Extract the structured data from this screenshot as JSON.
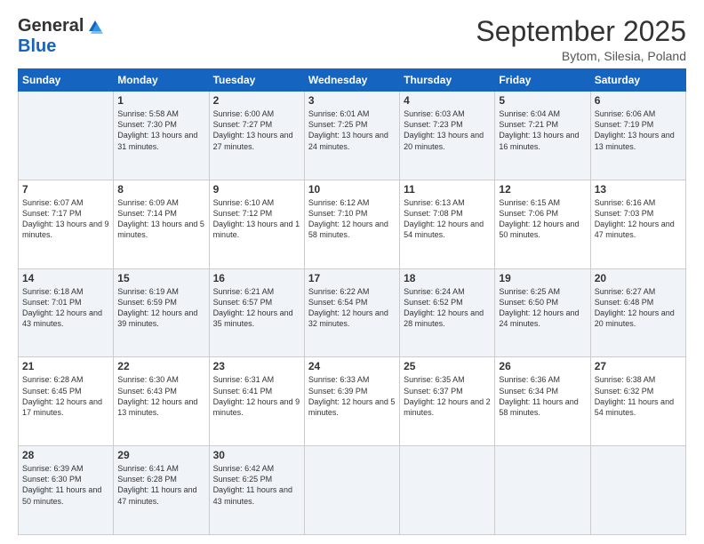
{
  "header": {
    "logo_general": "General",
    "logo_blue": "Blue",
    "month_title": "September 2025",
    "location": "Bytom, Silesia, Poland"
  },
  "weekdays": [
    "Sunday",
    "Monday",
    "Tuesday",
    "Wednesday",
    "Thursday",
    "Friday",
    "Saturday"
  ],
  "weeks": [
    [
      {
        "day": "",
        "sunrise": "",
        "sunset": "",
        "daylight": ""
      },
      {
        "day": "1",
        "sunrise": "Sunrise: 5:58 AM",
        "sunset": "Sunset: 7:30 PM",
        "daylight": "Daylight: 13 hours and 31 minutes."
      },
      {
        "day": "2",
        "sunrise": "Sunrise: 6:00 AM",
        "sunset": "Sunset: 7:27 PM",
        "daylight": "Daylight: 13 hours and 27 minutes."
      },
      {
        "day": "3",
        "sunrise": "Sunrise: 6:01 AM",
        "sunset": "Sunset: 7:25 PM",
        "daylight": "Daylight: 13 hours and 24 minutes."
      },
      {
        "day": "4",
        "sunrise": "Sunrise: 6:03 AM",
        "sunset": "Sunset: 7:23 PM",
        "daylight": "Daylight: 13 hours and 20 minutes."
      },
      {
        "day": "5",
        "sunrise": "Sunrise: 6:04 AM",
        "sunset": "Sunset: 7:21 PM",
        "daylight": "Daylight: 13 hours and 16 minutes."
      },
      {
        "day": "6",
        "sunrise": "Sunrise: 6:06 AM",
        "sunset": "Sunset: 7:19 PM",
        "daylight": "Daylight: 13 hours and 13 minutes."
      }
    ],
    [
      {
        "day": "7",
        "sunrise": "Sunrise: 6:07 AM",
        "sunset": "Sunset: 7:17 PM",
        "daylight": "Daylight: 13 hours and 9 minutes."
      },
      {
        "day": "8",
        "sunrise": "Sunrise: 6:09 AM",
        "sunset": "Sunset: 7:14 PM",
        "daylight": "Daylight: 13 hours and 5 minutes."
      },
      {
        "day": "9",
        "sunrise": "Sunrise: 6:10 AM",
        "sunset": "Sunset: 7:12 PM",
        "daylight": "Daylight: 13 hours and 1 minute."
      },
      {
        "day": "10",
        "sunrise": "Sunrise: 6:12 AM",
        "sunset": "Sunset: 7:10 PM",
        "daylight": "Daylight: 12 hours and 58 minutes."
      },
      {
        "day": "11",
        "sunrise": "Sunrise: 6:13 AM",
        "sunset": "Sunset: 7:08 PM",
        "daylight": "Daylight: 12 hours and 54 minutes."
      },
      {
        "day": "12",
        "sunrise": "Sunrise: 6:15 AM",
        "sunset": "Sunset: 7:06 PM",
        "daylight": "Daylight: 12 hours and 50 minutes."
      },
      {
        "day": "13",
        "sunrise": "Sunrise: 6:16 AM",
        "sunset": "Sunset: 7:03 PM",
        "daylight": "Daylight: 12 hours and 47 minutes."
      }
    ],
    [
      {
        "day": "14",
        "sunrise": "Sunrise: 6:18 AM",
        "sunset": "Sunset: 7:01 PM",
        "daylight": "Daylight: 12 hours and 43 minutes."
      },
      {
        "day": "15",
        "sunrise": "Sunrise: 6:19 AM",
        "sunset": "Sunset: 6:59 PM",
        "daylight": "Daylight: 12 hours and 39 minutes."
      },
      {
        "day": "16",
        "sunrise": "Sunrise: 6:21 AM",
        "sunset": "Sunset: 6:57 PM",
        "daylight": "Daylight: 12 hours and 35 minutes."
      },
      {
        "day": "17",
        "sunrise": "Sunrise: 6:22 AM",
        "sunset": "Sunset: 6:54 PM",
        "daylight": "Daylight: 12 hours and 32 minutes."
      },
      {
        "day": "18",
        "sunrise": "Sunrise: 6:24 AM",
        "sunset": "Sunset: 6:52 PM",
        "daylight": "Daylight: 12 hours and 28 minutes."
      },
      {
        "day": "19",
        "sunrise": "Sunrise: 6:25 AM",
        "sunset": "Sunset: 6:50 PM",
        "daylight": "Daylight: 12 hours and 24 minutes."
      },
      {
        "day": "20",
        "sunrise": "Sunrise: 6:27 AM",
        "sunset": "Sunset: 6:48 PM",
        "daylight": "Daylight: 12 hours and 20 minutes."
      }
    ],
    [
      {
        "day": "21",
        "sunrise": "Sunrise: 6:28 AM",
        "sunset": "Sunset: 6:45 PM",
        "daylight": "Daylight: 12 hours and 17 minutes."
      },
      {
        "day": "22",
        "sunrise": "Sunrise: 6:30 AM",
        "sunset": "Sunset: 6:43 PM",
        "daylight": "Daylight: 12 hours and 13 minutes."
      },
      {
        "day": "23",
        "sunrise": "Sunrise: 6:31 AM",
        "sunset": "Sunset: 6:41 PM",
        "daylight": "Daylight: 12 hours and 9 minutes."
      },
      {
        "day": "24",
        "sunrise": "Sunrise: 6:33 AM",
        "sunset": "Sunset: 6:39 PM",
        "daylight": "Daylight: 12 hours and 5 minutes."
      },
      {
        "day": "25",
        "sunrise": "Sunrise: 6:35 AM",
        "sunset": "Sunset: 6:37 PM",
        "daylight": "Daylight: 12 hours and 2 minutes."
      },
      {
        "day": "26",
        "sunrise": "Sunrise: 6:36 AM",
        "sunset": "Sunset: 6:34 PM",
        "daylight": "Daylight: 11 hours and 58 minutes."
      },
      {
        "day": "27",
        "sunrise": "Sunrise: 6:38 AM",
        "sunset": "Sunset: 6:32 PM",
        "daylight": "Daylight: 11 hours and 54 minutes."
      }
    ],
    [
      {
        "day": "28",
        "sunrise": "Sunrise: 6:39 AM",
        "sunset": "Sunset: 6:30 PM",
        "daylight": "Daylight: 11 hours and 50 minutes."
      },
      {
        "day": "29",
        "sunrise": "Sunrise: 6:41 AM",
        "sunset": "Sunset: 6:28 PM",
        "daylight": "Daylight: 11 hours and 47 minutes."
      },
      {
        "day": "30",
        "sunrise": "Sunrise: 6:42 AM",
        "sunset": "Sunset: 6:25 PM",
        "daylight": "Daylight: 11 hours and 43 minutes."
      },
      {
        "day": "",
        "sunrise": "",
        "sunset": "",
        "daylight": ""
      },
      {
        "day": "",
        "sunrise": "",
        "sunset": "",
        "daylight": ""
      },
      {
        "day": "",
        "sunrise": "",
        "sunset": "",
        "daylight": ""
      },
      {
        "day": "",
        "sunrise": "",
        "sunset": "",
        "daylight": ""
      }
    ]
  ]
}
